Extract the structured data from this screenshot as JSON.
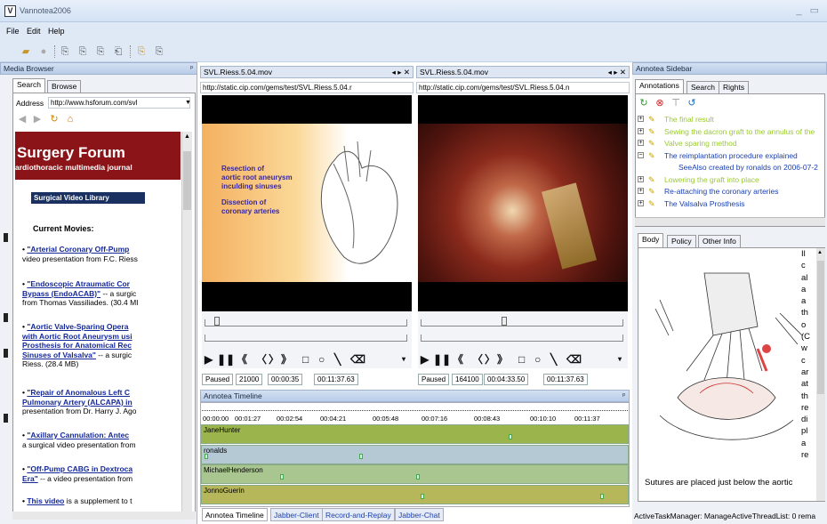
{
  "app": {
    "title": "Vannotea2006",
    "icon": "V",
    "window_controls": "_ ▭"
  },
  "menu": [
    "File",
    "Edit",
    "Help"
  ],
  "media_browser": {
    "title": "Media Browser",
    "pin": "ᵖ",
    "tabs": [
      "Search",
      "Browse"
    ],
    "address_label": "Address",
    "address_value": "http://www.hsforum.com/svl",
    "site_title": "Surgery Forum",
    "site_subtitle": "ardiothoracic multimedia journal",
    "library_box": "Surgical Video Library",
    "current_movies": "Current Movies:",
    "movies": [
      {
        "link": "\"Arterial Coronary Off-Pump",
        "rest": [
          "video presentation from F.C. Riess"
        ]
      },
      {
        "link": "\"Endoscopic Atraumatic Cor",
        "link2": "Bypass (EndoACAB)\"",
        "rest": [
          " -- a surgic",
          "from Thomas Vassiliades. (30.4 MI"
        ]
      },
      {
        "link": "\"Aortic Valve-Sparing Opera",
        "link2": "with Aortic Root Aneurysm usi",
        "link3": "Prosthesis for Anatomical Rec",
        "link4": "Sinuses of Valsalva\"",
        "rest": [
          " -- a surgic",
          "Riess. (28.4 MB)"
        ]
      },
      {
        "link": "\"Repair of Anomalous Left C",
        "link2": "Pulmonary Artery (ALCAPA) in",
        "rest": [
          "presentation from Dr. Harry J. Ago"
        ]
      },
      {
        "link": "\"Axillary Cannulation: Antec",
        "rest": [
          "a surgical video presentation from"
        ]
      },
      {
        "link": "\"Off-Pump CABG in Dextroca",
        "link2": "Era\"",
        "rest": [
          " -- a video presentation from"
        ]
      },
      {
        "link": "This video",
        "rest": [
          " is a supplement to t"
        ]
      }
    ]
  },
  "video1": {
    "title": "SVL.Riess.5.04.mov",
    "url": "http://static.cip.com/gems/test/SVL.Riess.5.04.r",
    "slide_text_1": "Resection of",
    "slide_text_2": "aortic root aneurysm",
    "slide_text_3": "inculding sinuses",
    "slide_text_4": "Dissection of",
    "slide_text_5": "coronary arteries",
    "status": "Paused",
    "frame": "21000",
    "time": "00:00:35",
    "duration": "00:11:37.63"
  },
  "video2": {
    "title": "SVL.Riess.5.04.mov",
    "url": "http://static.cip.com/gems/test/SVL.Riess.5.04.n",
    "status": "Paused",
    "frame": "164100",
    "time": "00:04:33.50",
    "duration": "00:11:37.63"
  },
  "controls": {
    "play": "▶",
    "pause": "❚❚",
    "rewind": "《",
    "prev": "〈",
    "next": "〉",
    "forward": "》",
    "rect": "□",
    "oval": "○",
    "line": "╲",
    "erase": "⌫"
  },
  "timeline": {
    "title": "Annotea Timeline",
    "ticks": [
      "00:00:00",
      "00:01:27",
      "00:02:54",
      "00:04:21",
      "00:05:48",
      "00:07:16",
      "00:08:43",
      "00:10:10",
      "00:11:37"
    ],
    "rows": [
      {
        "name": "JaneHunter",
        "color": "#9cb44c"
      },
      {
        "name": "ronalds",
        "color": "#b5c9d5"
      },
      {
        "name": "MichaelHenderson",
        "color": "#a9c590"
      },
      {
        "name": "JonnoGuerin",
        "color": "#b6b65a"
      }
    ]
  },
  "bottom_tabs": [
    "Annotea Timeline",
    "Jabber-Client",
    "Record-and-Replay",
    "Jabber-Chat"
  ],
  "sidebar": {
    "title": "Annotea Sidebar",
    "tabs": [
      "Annotations",
      "Search",
      "Rights"
    ],
    "annotations": [
      {
        "text": "The final result",
        "color": "#9acb2f"
      },
      {
        "text": "Sewing the dacron graft to the annulus of the",
        "color": "#9acb2f"
      },
      {
        "text": "Valve sparing method",
        "color": "#9acb2f"
      },
      {
        "text": "The reimplantation procedure explained",
        "color": "#1a3fb0"
      },
      {
        "text": "SeeAlso created by ronalds on 2006-07-2",
        "color": "#1a3fb0"
      },
      {
        "text": "Lowering the graft into place",
        "color": "#9acb2f"
      },
      {
        "text": "Re-attaching the coronary arteries",
        "color": "#1a3fb0"
      },
      {
        "text": "The Valsalva Prosthesis",
        "color": "#1a3fb0"
      }
    ],
    "detail_tabs": [
      "Body",
      "Policy",
      "Other Info"
    ],
    "side_text": [
      "Il",
      "c",
      "al",
      "a",
      "a",
      "th",
      "o",
      "(C",
      "w",
      "c",
      "ar",
      "at",
      "th",
      "re",
      "di",
      "pl",
      "a",
      "re"
    ],
    "caption": "Sutures are placed just below the aortic"
  },
  "status_bar": "ActiveTaskManager: ManageActiveThreadList: 0 rema"
}
